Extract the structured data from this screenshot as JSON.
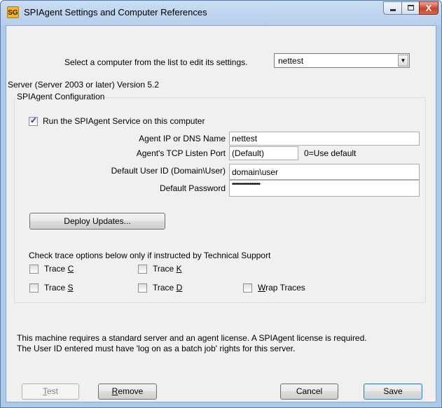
{
  "window": {
    "title": "SPIAgent Settings and Computer References",
    "app_icon_text": "SG",
    "close_glyph": "X"
  },
  "selector": {
    "prompt": "Select a computer from the list to edit its settings.",
    "selected": "nettest"
  },
  "server_version": "Server (Server 2003 or later) Version 5.2",
  "config": {
    "group_title": "SPIAgent Configuration",
    "run_service": {
      "pre": "Run the SPIA",
      "accel": "g",
      "post": "ent Service on this computer",
      "checked": true
    },
    "agent_ip_label": "Agent IP or DNS Name",
    "agent_ip_value": "nettest",
    "tcp_port_label": "Agent's TCP Listen Port",
    "tcp_port_value": "(Default)",
    "tcp_port_hint": "0=Use default",
    "user_id_label": "Default User ID (Domain\\User)",
    "user_id_value": "domain\\user",
    "password_label": "Default Password",
    "password_value": "••••••••••••••••",
    "deploy_button": "Deploy Updates...",
    "trace_note": "Check trace options below only if instructed by Technical Support",
    "traces": [
      {
        "pre": "Trace ",
        "accel": "C",
        "post": "",
        "checked": false
      },
      {
        "pre": "Trace ",
        "accel": "K",
        "post": "",
        "checked": false
      },
      {
        "pre": "Trace ",
        "accel": "S",
        "post": "",
        "checked": false
      },
      {
        "pre": "Trace ",
        "accel": "D",
        "post": "",
        "checked": false
      },
      {
        "pre": "",
        "accel": "W",
        "post": "rap Traces",
        "checked": false
      }
    ]
  },
  "info": {
    "line1": "This machine requires a standard server and an agent license. A SPIAgent license is required.",
    "line2": "The User ID entered must have 'log on as a batch job' rights for this server."
  },
  "buttons": {
    "test": {
      "accel": "T",
      "post": "est",
      "enabled": false
    },
    "remove": {
      "accel": "R",
      "post": "emove"
    },
    "cancel": "Cancel",
    "save": "Save"
  }
}
